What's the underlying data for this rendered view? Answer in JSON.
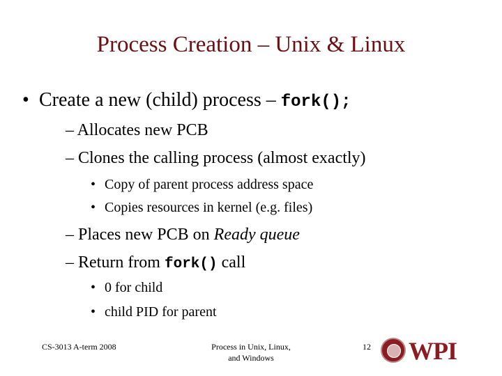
{
  "slide": {
    "title": "Process Creation – Unix & Linux",
    "bullets": {
      "b1": {
        "text": "Create a new (child) process – ",
        "code": "fork();"
      },
      "b1_1": "– Allocates new PCB",
      "b1_2": "– Clones the calling process (almost exactly)",
      "b1_2_1": "Copy of parent process address space",
      "b1_2_2": "Copies resources in kernel (e.g. files)",
      "b1_3": {
        "prefix": "– Places new PCB on ",
        "italic": "Ready queue"
      },
      "b1_4": {
        "prefix": "– Return from ",
        "code": "fork()",
        "suffix": " call"
      },
      "b1_4_1": "0 for child",
      "b1_4_2": "child PID for parent"
    },
    "bullet_glyph": "•"
  },
  "footer": {
    "left": "CS-3013 A-term 2008",
    "center_line1": "Process in Unix, Linux,",
    "center_line2": "and Windows",
    "page_number": "12",
    "logo_text": "WPI",
    "logo_icon": "wpi-seal-icon"
  },
  "colors": {
    "title": "#6b0f12",
    "logo": "#8a1c22"
  }
}
